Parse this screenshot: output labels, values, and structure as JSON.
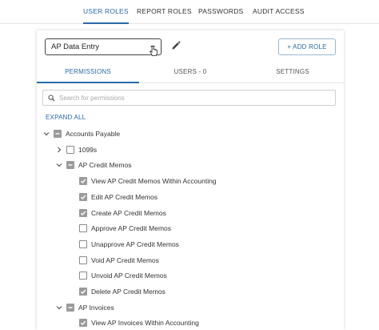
{
  "top_nav": {
    "tabs": [
      {
        "label": "USER ROLES",
        "active": true
      },
      {
        "label": "REPORT ROLES",
        "active": false
      },
      {
        "label": "PASSWORDS",
        "active": false
      },
      {
        "label": "AUDIT ACCESS",
        "active": false
      }
    ]
  },
  "role_selector": {
    "value": "AP Data Entry"
  },
  "add_role_label": "+ ADD ROLE",
  "sub_tabs": [
    {
      "label": "PERMISSIONS",
      "active": true
    },
    {
      "label": "USERS - 0",
      "active": false
    },
    {
      "label": "SETTINGS",
      "active": false
    }
  ],
  "search": {
    "placeholder": "Search for permissions"
  },
  "expand_all_label": "EXPAND ALL",
  "tree": [
    {
      "label": "Accounts Payable",
      "level": 0,
      "chevron": "down",
      "state": "indeterminate"
    },
    {
      "label": "1099s",
      "level": 1,
      "chevron": "right",
      "state": "unchecked"
    },
    {
      "label": "AP Credit Memos",
      "level": 1,
      "chevron": "down",
      "state": "indeterminate"
    },
    {
      "label": "View AP Credit Memos Within Accounting",
      "level": 2,
      "chevron": "none",
      "state": "checked"
    },
    {
      "label": "Edit AP Credit Memos",
      "level": 2,
      "chevron": "none",
      "state": "checked"
    },
    {
      "label": "Create AP Credit Memos",
      "level": 2,
      "chevron": "none",
      "state": "checked"
    },
    {
      "label": "Approve AP Credit Memos",
      "level": 2,
      "chevron": "none",
      "state": "unchecked"
    },
    {
      "label": "Unapprove AP Credit Memos",
      "level": 2,
      "chevron": "none",
      "state": "unchecked"
    },
    {
      "label": "Void AP Credit Memos",
      "level": 2,
      "chevron": "none",
      "state": "unchecked"
    },
    {
      "label": "Unvoid AP Credit Memos",
      "level": 2,
      "chevron": "none",
      "state": "unchecked"
    },
    {
      "label": "Delete AP Credit Memos",
      "level": 2,
      "chevron": "none",
      "state": "checked"
    },
    {
      "label": "AP Invoices",
      "level": 1,
      "chevron": "down",
      "state": "indeterminate"
    },
    {
      "label": "View AP Invoices Within Accounting",
      "level": 2,
      "chevron": "none",
      "state": "checked"
    }
  ],
  "colors": {
    "accent": "#2a6aa8",
    "checkbox_fill": "#9a9a9a"
  }
}
